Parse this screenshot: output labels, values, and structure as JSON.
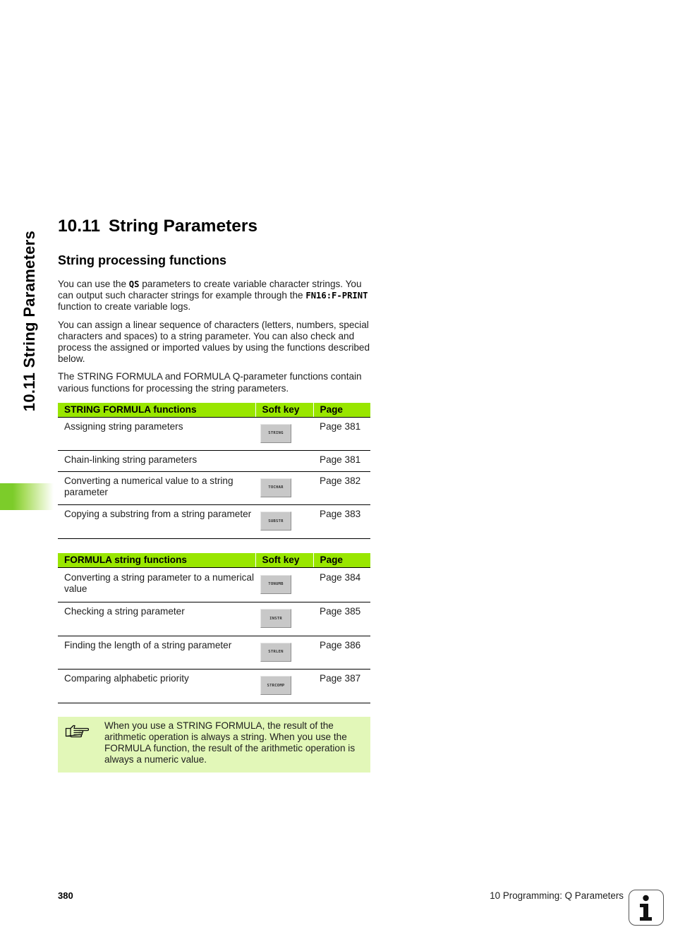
{
  "side_tab": {
    "title": "10.11 String Parameters",
    "accent_color": "#7ccc2a"
  },
  "section": {
    "number": "10.11",
    "title": "String Parameters"
  },
  "subsection": {
    "title": "String processing functions"
  },
  "paragraphs": {
    "p1": {
      "pre": "You can use the ",
      "kw1": "QS",
      "mid": " parameters to create variable character strings. You can output such character strings for example through the ",
      "kw2": "FN16:F-PRINT",
      "post": " function to create variable logs."
    },
    "p2": "You can assign a linear sequence of characters (letters, numbers, special characters and spaces) to a string parameter. You can also check and process the assigned or imported values by using the functions described below.",
    "p3": "The STRING FORMULA and FORMULA Q-parameter functions contain various functions for processing the string parameters."
  },
  "table_string_formula": {
    "header_color": "#99e600",
    "columns": [
      "STRING FORMULA functions",
      "Soft key",
      "Page"
    ],
    "rows": [
      {
        "function": "Assigning string parameters",
        "softkey": "STRING",
        "page": "Page 381"
      },
      {
        "function": "Chain-linking string parameters",
        "softkey": "",
        "page": "Page 381"
      },
      {
        "function": "Converting a numerical value to a string parameter",
        "softkey": "TOCHAR",
        "page": "Page 382"
      },
      {
        "function": "Copying a substring from a string parameter",
        "softkey": "SUBSTR",
        "page": "Page 383"
      }
    ]
  },
  "table_formula_string": {
    "header_color": "#99e600",
    "columns": [
      "FORMULA string functions",
      "Soft key",
      "Page"
    ],
    "rows": [
      {
        "function": "Converting a string parameter to a numerical value",
        "softkey": "TONUMB",
        "page": "Page 384"
      },
      {
        "function": "Checking a string parameter",
        "softkey": "INSTR",
        "page": "Page 385"
      },
      {
        "function": "Finding the length of a string parameter",
        "softkey": "STRLEN",
        "page": "Page 386"
      },
      {
        "function": "Comparing alphabetic priority",
        "softkey": "STRCOMP",
        "page": "Page 387"
      }
    ]
  },
  "note": {
    "icon": "pointing-hand-icon",
    "background": "#e2f7b8",
    "text": "When you use a STRING FORMULA, the result of the arithmetic operation is always a string. When you use the FORMULA function, the result of the arithmetic operation is always a numeric value."
  },
  "footer": {
    "page_number": "380",
    "chapter": "10 Programming: Q Parameters",
    "icon": "info-icon"
  }
}
